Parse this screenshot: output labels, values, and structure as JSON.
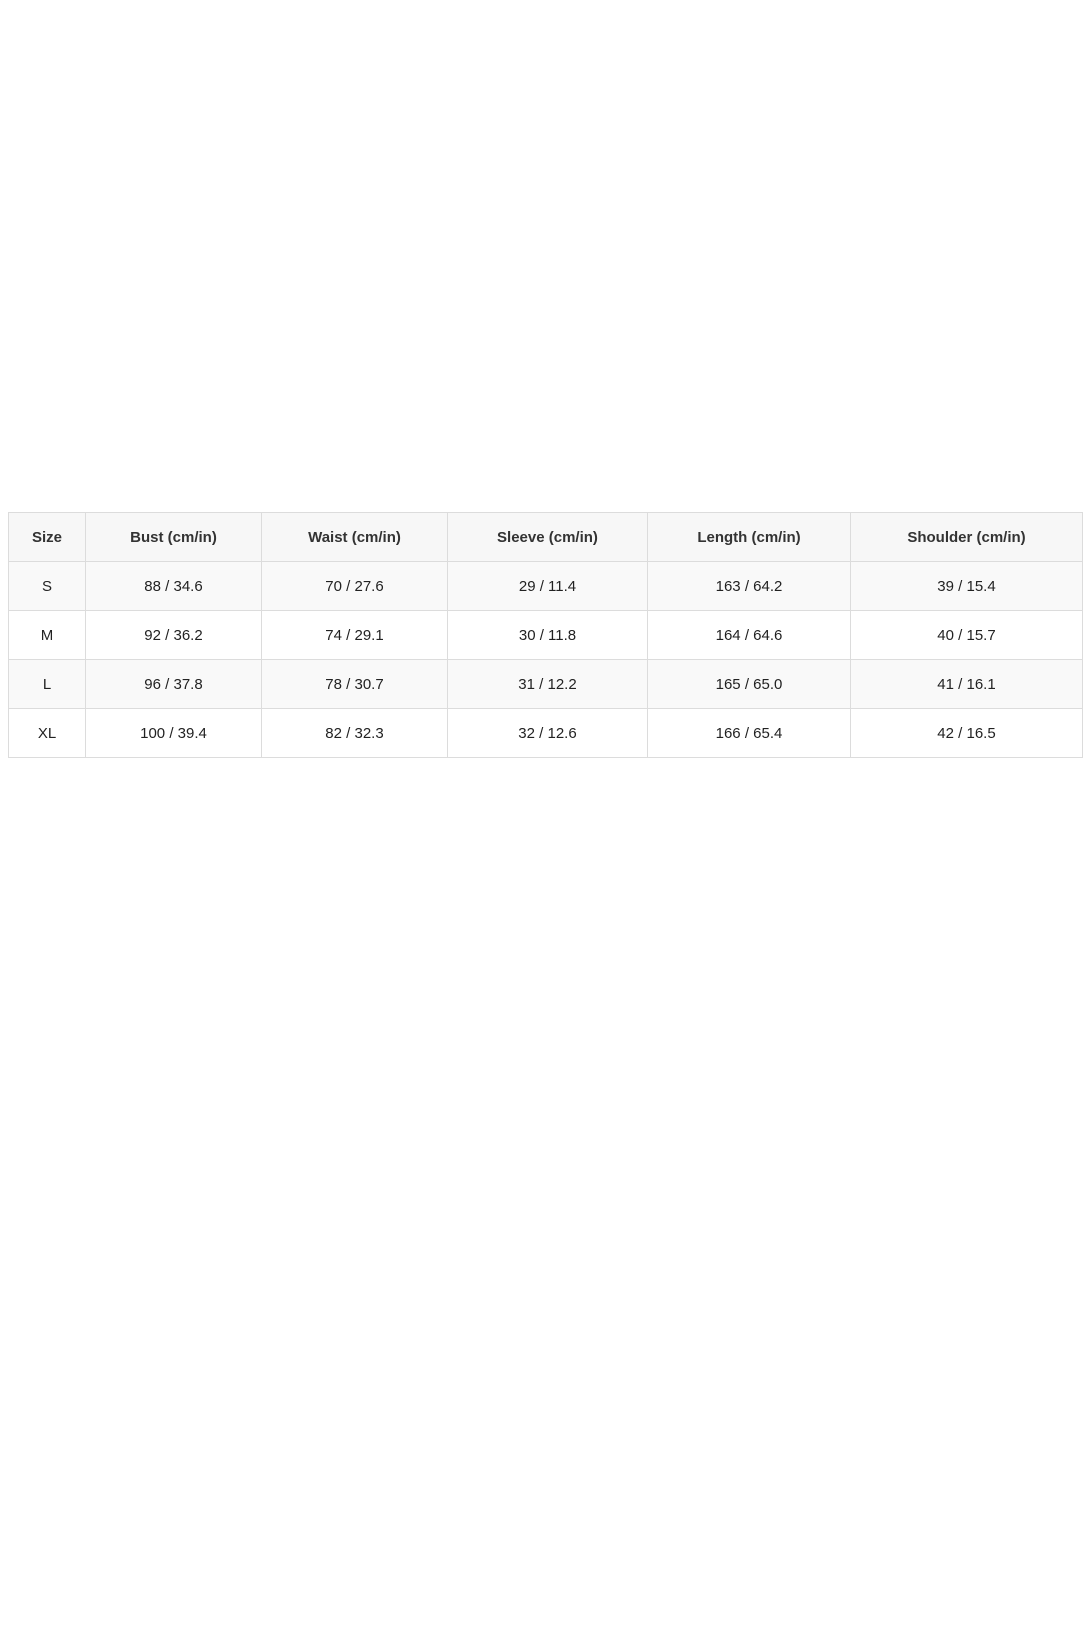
{
  "size_chart": {
    "headers": [
      "Size",
      "Bust (cm/in)",
      "Waist (cm/in)",
      "Sleeve (cm/in)",
      "Length (cm/in)",
      "Shoulder (cm/in)"
    ],
    "rows": [
      [
        "S",
        "88 / 34.6",
        "70 / 27.6",
        "29 / 11.4",
        "163 / 64.2",
        "39 / 15.4"
      ],
      [
        "M",
        "92 / 36.2",
        "74 / 29.1",
        "30 / 11.8",
        "164 / 64.6",
        "40 / 15.7"
      ],
      [
        "L",
        "96 / 37.8",
        "78 / 30.7",
        "31 / 12.2",
        "165 / 65.0",
        "41 / 16.1"
      ],
      [
        "XL",
        "100 / 39.4",
        "82 / 32.3",
        "32 / 12.6",
        "166 / 65.4",
        "42 / 16.5"
      ]
    ]
  }
}
